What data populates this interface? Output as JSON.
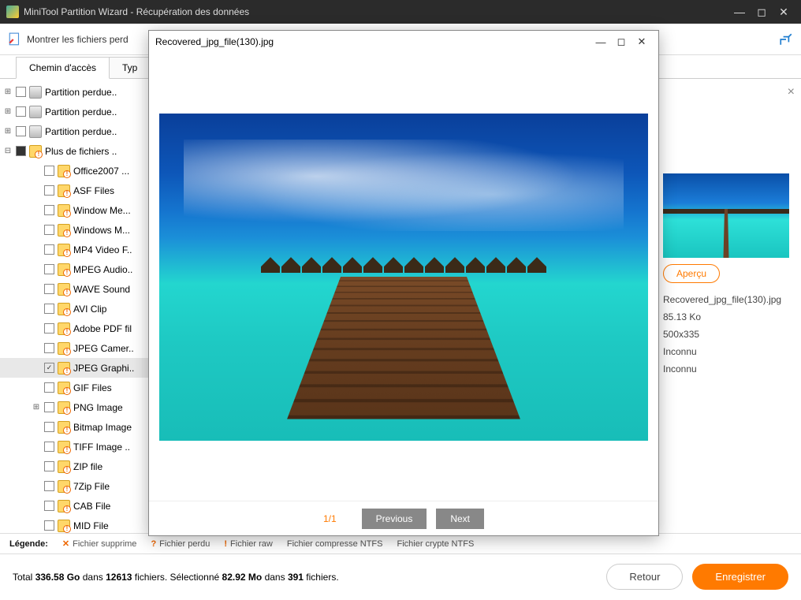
{
  "title": "MiniTool Partition Wizard - Récupération des données",
  "toolbar": {
    "showLost": "Montrer les fichiers perd"
  },
  "tabs": {
    "path": "Chemin d'accès",
    "type": "Typ"
  },
  "tree": {
    "partitions": [
      "Partition perdue..",
      "Partition perdue..",
      "Partition perdue.."
    ],
    "moreFiles": "Plus de fichiers ..",
    "folders": [
      "Office2007 ...",
      "ASF Files",
      "Window Me...",
      "Windows M...",
      "MP4 Video F..",
      "MPEG Audio..",
      "WAVE Sound",
      "AVI Clip",
      "Adobe PDF fil",
      "JPEG Camer..",
      "JPEG Graphi..",
      "GIF Files",
      "PNG Image",
      "Bitmap Image",
      "TIFF Image ..",
      "ZIP file",
      "7Zip File",
      "CAB File",
      "MID File"
    ],
    "selectedIndex": 10
  },
  "preview": {
    "filename": "Recovered_jpg_file(130).jpg",
    "counter": "1/1",
    "prev": "Previous",
    "next": "Next"
  },
  "side": {
    "apercu": "Aperçu",
    "name": "Recovered_jpg_file(130).jpg",
    "size": "85.13 Ko",
    "dims": "500x335",
    "unk1": "Inconnu",
    "unk2": "Inconnu"
  },
  "legend": {
    "label": "Légende:",
    "del": "Fichier supprime",
    "lost": "Fichier perdu",
    "raw": "Fichier raw",
    "ntfsC": "Fichier compresse NTFS",
    "ntfsE": "Fichier crypte NTFS"
  },
  "status": {
    "t1": "Total ",
    "total": "336.58 Go",
    " t2": " dans ",
    "files": "12613",
    " t3": " fichiers. ",
    "t4": " Sélectionné ",
    "sel": "82.92 Mo",
    " t5": " dans ",
    "selFiles": "391",
    " t6": " fichiers."
  },
  "buttons": {
    "retour": "Retour",
    "save": "Enregistrer"
  }
}
